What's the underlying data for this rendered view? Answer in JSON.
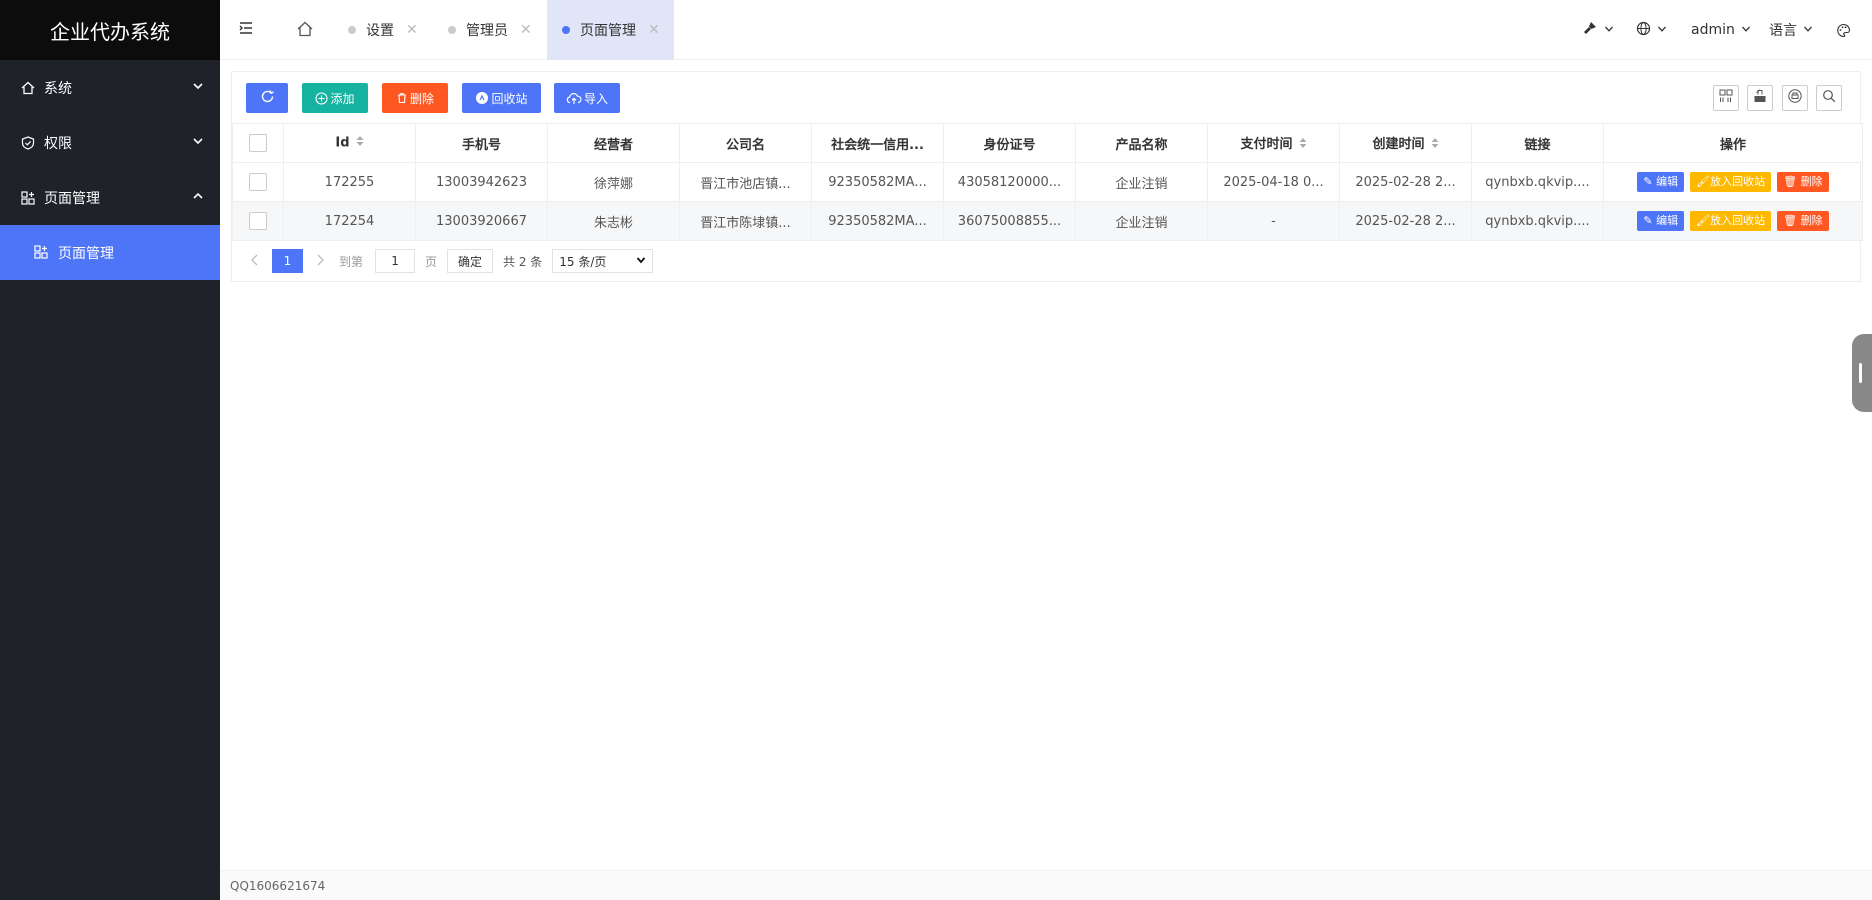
{
  "app": {
    "title": "企业代办系统"
  },
  "sidebar": {
    "items": [
      {
        "label": "系统",
        "icon": "home-icon",
        "expanded": false
      },
      {
        "label": "权限",
        "icon": "shield-check-icon",
        "expanded": false
      },
      {
        "label": "页面管理",
        "icon": "grid-icon",
        "expanded": true
      }
    ],
    "sub_items": [
      {
        "label": "页面管理",
        "icon": "grid-icon",
        "active": true
      }
    ]
  },
  "header": {
    "tabs": [
      {
        "label": "设置",
        "active": false
      },
      {
        "label": "管理员",
        "active": false
      },
      {
        "label": "页面管理",
        "active": true
      }
    ],
    "user": "admin",
    "language": "语言"
  },
  "toolbar": {
    "refresh_label": "",
    "add_label": "添加",
    "delete_label": "删除",
    "recycle_label": "回收站",
    "import_label": "导入"
  },
  "table": {
    "columns": [
      "Id",
      "手机号",
      "经营者",
      "公司名",
      "社会统一信用...",
      "身份证号",
      "产品名称",
      "支付时间",
      "创建时间",
      "链接",
      "操作"
    ],
    "rows": [
      {
        "id": "172255",
        "phone": "13003942623",
        "operator": "徐萍娜",
        "company": "晋江市池店镇...",
        "credit_code": "92350582MA...",
        "id_card": "43058120000...",
        "product": "企业注销",
        "pay_time": "2025-04-18 0...",
        "create_time": "2025-02-28 2...",
        "link": "qynbxb.qkvip...."
      },
      {
        "id": "172254",
        "phone": "13003920667",
        "operator": "朱志彬",
        "company": "晋江市陈埭镇...",
        "credit_code": "92350582MA...",
        "id_card": "36075008855...",
        "product": "企业注销",
        "pay_time": "-",
        "create_time": "2025-02-28 2...",
        "link": "qynbxb.qkvip...."
      }
    ],
    "actions": {
      "edit": "编辑",
      "recycle": "放入回收站",
      "delete": "删除"
    }
  },
  "pager": {
    "current_page": "1",
    "goto_label": "到第",
    "goto_value": "1",
    "page_suffix": "页",
    "confirm": "确定",
    "total": "共 2 条",
    "page_size": "15 条/页"
  },
  "footer": {
    "text": "QQ1606621674"
  },
  "colors": {
    "primary": "#4e75f7",
    "teal": "#16b3a1",
    "orange": "#ff5722",
    "yellow": "#ffb800",
    "sidebar": "#20222a"
  }
}
